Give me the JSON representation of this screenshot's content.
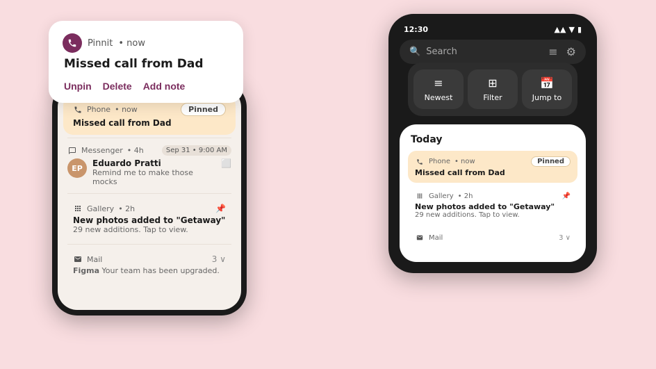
{
  "scene": {
    "bg_color": "#f9dde0"
  },
  "popup": {
    "app_name": "Pinnit",
    "time": "now",
    "title": "Missed call from Dad",
    "actions": [
      "Unpin",
      "Delete",
      "Add note"
    ]
  },
  "left_phone": {
    "notifications": [
      {
        "app": "Phone",
        "time": "now",
        "pinned": true,
        "badge": "Pinned",
        "text": "Missed call from Dad"
      },
      {
        "app": "Messenger",
        "time": "4h",
        "date_badge": "Sep 31 • 9:00 AM",
        "has_avatar": true,
        "avatar_initials": "EP",
        "sender": "Eduardo Pratti",
        "text": "Remind me to make those mocks"
      },
      {
        "app": "Gallery",
        "time": "2h",
        "text": "New photos added to \"Getaway\"",
        "sub": "29 new additions. Tap to view.",
        "pinned": false,
        "has_pin_icon": true
      },
      {
        "app": "Mail",
        "time": "",
        "count": "3",
        "text": "Figma",
        "sub": "Your team has been upgraded."
      }
    ]
  },
  "right_phone": {
    "status_bar": {
      "time": "12:30"
    },
    "search_placeholder": "Search",
    "action_buttons": [
      {
        "label": "Newest",
        "icon": "≡"
      },
      {
        "label": "Filter",
        "icon": "⊞"
      },
      {
        "label": "Jump to",
        "icon": "📅"
      }
    ],
    "today_label": "Today",
    "notifications": [
      {
        "app": "Phone",
        "time": "now",
        "pinned": true,
        "badge": "Pinned",
        "text": "Missed call from Dad"
      },
      {
        "app": "Gallery",
        "time": "2h",
        "text": "New photos added to \"Getaway\"",
        "sub": "29 new additions. Tap to view.",
        "has_pin_icon": true
      },
      {
        "app": "Mail",
        "time": "",
        "count": "3",
        "text": ""
      }
    ]
  }
}
